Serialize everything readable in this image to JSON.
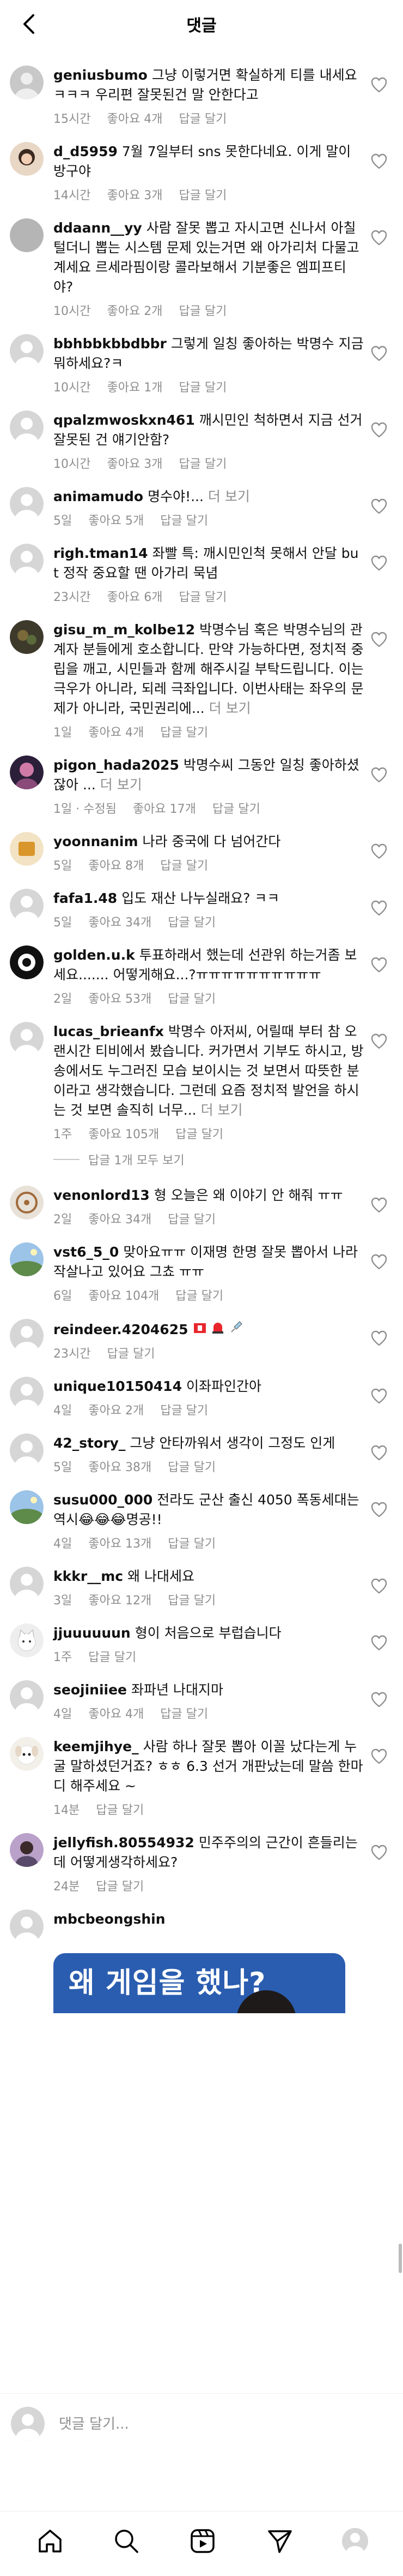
{
  "header": {
    "title": "댓글"
  },
  "comments": [
    {
      "user": "geniusbumo",
      "text": "그냥 이렇거면 확실하게 티를 내세요 ㅋㅋㅋ 우리편 잘못된건 말 안한다고",
      "time": "15시간",
      "likes": "좋아요 4개",
      "reply": "답글 달기",
      "av": "grey"
    },
    {
      "user": "d_d5959",
      "text": "7월 7일부터 sns 못한다네요. 이게 말이 방구야",
      "time": "14시간",
      "likes": "좋아요 3개",
      "reply": "답글 달기",
      "av": "photo-girl"
    },
    {
      "user": "ddaann__yy",
      "text": "사람 잘못 뽑고 자시고면 신나서 아칠 털더니 뽑는 시스템 문제 있는거면 왜 아가리처 다물고 계세요 르세라핌이랑 콜라보해서 기분좋은 엠피프티야?",
      "time": "10시간",
      "likes": "좋아요 2개",
      "reply": "답글 달기",
      "av": "grey-solid"
    },
    {
      "user": "bbhbbkbbdbbr",
      "text": "그렇게 일칭 좋아하는 박명수 지금 뭐하세요?ㅋ",
      "time": "10시간",
      "likes": "좋아요 1개",
      "reply": "답글 달기",
      "av": "default"
    },
    {
      "user": "qpalzmwoskxn461",
      "text": "깨시민인 척하면서 지금 선거잘못된 건 얘기안함?",
      "time": "10시간",
      "likes": "좋아요 3개",
      "reply": "답글 달기",
      "av": "default"
    },
    {
      "user": "animamudo",
      "text": "명수야!...",
      "more": "더 보기",
      "time": "5일",
      "likes": "좋아요 5개",
      "reply": "답글 달기",
      "av": "default"
    },
    {
      "user": "righ.tman14",
      "text": "좌빨 특: 깨시민인척 못해서 안달 but 정작 중요할 땐 아가리 묵념",
      "time": "23시간",
      "likes": "좋아요 6개",
      "reply": "답글 달기",
      "av": "default"
    },
    {
      "user": "gisu_m_m_kolbe12",
      "text": "박명수님 혹은 박명수님의 관계자 분들에게 호소합니다. 만약 가능하다면, 정치적 중립을 깨고, 시민들과 함께 해주시길 부탁드립니다. 이는 극우가 아니라, 되레 극좌입니다. 이번사태는 좌우의 문제가 아니라, 국민권리에...",
      "more": "더 보기",
      "time": "1일",
      "likes": "좋아요 4개",
      "reply": "답글 달기",
      "av": "photo-dark"
    },
    {
      "user": "pigon_hada2025",
      "text": "박명수씨 그동안 일칭 좋아하셨잖아 ...",
      "more": "더 보기",
      "time": "1일 · 수정됨",
      "likes": "좋아요 17개",
      "reply": "답글 달기",
      "av": "photo-pink"
    },
    {
      "user": "yoonnanim",
      "text": "나라 중국에 다 넘어간다",
      "time": "5일",
      "likes": "좋아요 8개",
      "reply": "답글 달기",
      "av": "photo-amber"
    },
    {
      "user": "fafa1.48",
      "text": "입도 재산 나누실래요? ㅋㅋ",
      "time": "5일",
      "likes": "좋아요 34개",
      "reply": "답글 달기",
      "av": "default"
    },
    {
      "user": "golden.u.k",
      "text": "투표하래서 했는데 선관위 하는거좀 보세요....... 어떻게해요...?ㅠㅠㅠㅠㅠㅠㅠㅠㅠㅠ",
      "time": "2일",
      "likes": "좋아요 53개",
      "reply": "답글 달기",
      "av": "photo-ball"
    },
    {
      "user": "lucas_brieanfx",
      "text": "박명수 아저씨, 어릴때 부터 참 오랜시간 티비에서 봤습니다. 커가면서 기부도 하시고, 방송에서도 누그러진 모습 보이시는 것 보면서 따뜻한 분이라고 생각했습니다. 그런데 요즘 정치적 발언을 하시는 것 보면 솔직히 너무...",
      "more": "더 보기",
      "time": "1주",
      "likes": "좋아요 105개",
      "reply": "답글 달기",
      "av": "default",
      "replies": "답글 1개 모두 보기"
    },
    {
      "user": "venonlord13",
      "text": "형 오늘은 왜 이야기 안 해줘 ㅠㅠ",
      "time": "2일",
      "likes": "좋아요 34개",
      "reply": "답글 달기",
      "av": "photo-wheel"
    },
    {
      "user": "vst6_5_0",
      "text": "맞아요ㅠㅠ 이재명 한명 잘못 뽑아서 나라 작살나고 있어요 그쵸 ㅠㅠ",
      "time": "6일",
      "likes": "좋아요 104개",
      "reply": "답글 달기",
      "av": "photo-sky"
    },
    {
      "user": "reindeer.4204625",
      "text": "",
      "badge": true,
      "time": "23시간",
      "likes": "",
      "reply": "답글 달기",
      "av": "default"
    },
    {
      "user": "unique10150414",
      "text": "이좌파인간아",
      "time": "4일",
      "likes": "좋아요 2개",
      "reply": "답글 달기",
      "av": "default"
    },
    {
      "user": "42_story_",
      "text": "그냥 안타까워서 생각이 그정도 인게",
      "time": "5일",
      "likes": "좋아요 38개",
      "reply": "답글 달기",
      "av": "default"
    },
    {
      "user": "susu000_000",
      "text": "전라도 군산 출신 4050 폭동세대는 역시😂😂😂명공!!",
      "time": "4일",
      "likes": "좋아요 13개",
      "reply": "답글 달기",
      "av": "photo-sky"
    },
    {
      "user": "kkkr__mc",
      "text": "왜 나대세요",
      "time": "3일",
      "likes": "좋아요 12개",
      "reply": "답글 달기",
      "av": "default"
    },
    {
      "user": "jjuuuuuun",
      "text": "형이 처음으로 부럽습니다",
      "time": "1주",
      "likes": "",
      "reply": "답글 달기",
      "av": "photo-cat"
    },
    {
      "user": "seojiniiee",
      "text": "좌파년 나대지마",
      "time": "4일",
      "likes": "좋아요 4개",
      "reply": "답글 달기",
      "av": "default"
    },
    {
      "user": "keemjihye_",
      "text": "사람 하나 잘못 뽑아 이꼴 났다는게 누굴 말하셨던거죠? ㅎㅎ 6.3 선거 개판났는데 말씀 한마디 해주세요 ~",
      "time": "14분",
      "likes": "",
      "reply": "답글 달기",
      "av": "photo-dog"
    },
    {
      "user": "jellyfish.80554932",
      "text": "민주주의의 근간이 흔들리는데 어떻게생각하세요?",
      "time": "24분",
      "likes": "",
      "reply": "답글 달기",
      "av": "photo-purple"
    },
    {
      "user": "mbcbeongshin",
      "text": "",
      "post": true,
      "av": "default"
    }
  ],
  "post_card": {
    "title": "왜 게임을 했나?"
  },
  "input": {
    "placeholder": "댓글 달기..."
  },
  "nav": [
    "home-icon",
    "search-icon",
    "reels-icon",
    "send-icon",
    "profile-icon"
  ]
}
